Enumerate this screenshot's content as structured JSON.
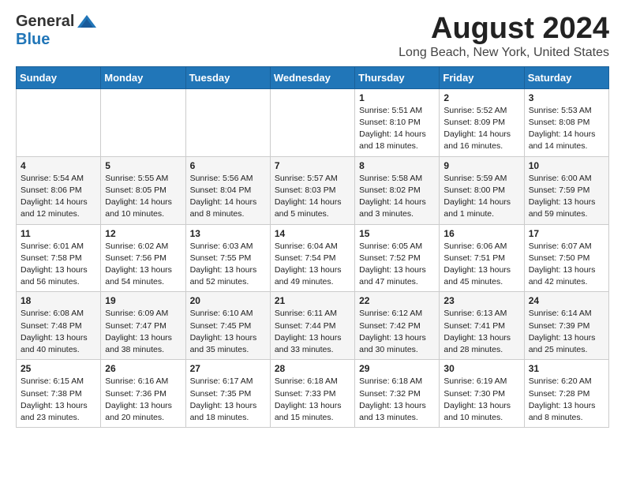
{
  "header": {
    "logo_general": "General",
    "logo_blue": "Blue",
    "title": "August 2024",
    "subtitle": "Long Beach, New York, United States"
  },
  "days_of_week": [
    "Sunday",
    "Monday",
    "Tuesday",
    "Wednesday",
    "Thursday",
    "Friday",
    "Saturday"
  ],
  "weeks": [
    [
      {
        "day": "",
        "detail": ""
      },
      {
        "day": "",
        "detail": ""
      },
      {
        "day": "",
        "detail": ""
      },
      {
        "day": "",
        "detail": ""
      },
      {
        "day": "1",
        "detail": "Sunrise: 5:51 AM\nSunset: 8:10 PM\nDaylight: 14 hours\nand 18 minutes."
      },
      {
        "day": "2",
        "detail": "Sunrise: 5:52 AM\nSunset: 8:09 PM\nDaylight: 14 hours\nand 16 minutes."
      },
      {
        "day": "3",
        "detail": "Sunrise: 5:53 AM\nSunset: 8:08 PM\nDaylight: 14 hours\nand 14 minutes."
      }
    ],
    [
      {
        "day": "4",
        "detail": "Sunrise: 5:54 AM\nSunset: 8:06 PM\nDaylight: 14 hours\nand 12 minutes."
      },
      {
        "day": "5",
        "detail": "Sunrise: 5:55 AM\nSunset: 8:05 PM\nDaylight: 14 hours\nand 10 minutes."
      },
      {
        "day": "6",
        "detail": "Sunrise: 5:56 AM\nSunset: 8:04 PM\nDaylight: 14 hours\nand 8 minutes."
      },
      {
        "day": "7",
        "detail": "Sunrise: 5:57 AM\nSunset: 8:03 PM\nDaylight: 14 hours\nand 5 minutes."
      },
      {
        "day": "8",
        "detail": "Sunrise: 5:58 AM\nSunset: 8:02 PM\nDaylight: 14 hours\nand 3 minutes."
      },
      {
        "day": "9",
        "detail": "Sunrise: 5:59 AM\nSunset: 8:00 PM\nDaylight: 14 hours\nand 1 minute."
      },
      {
        "day": "10",
        "detail": "Sunrise: 6:00 AM\nSunset: 7:59 PM\nDaylight: 13 hours\nand 59 minutes."
      }
    ],
    [
      {
        "day": "11",
        "detail": "Sunrise: 6:01 AM\nSunset: 7:58 PM\nDaylight: 13 hours\nand 56 minutes."
      },
      {
        "day": "12",
        "detail": "Sunrise: 6:02 AM\nSunset: 7:56 PM\nDaylight: 13 hours\nand 54 minutes."
      },
      {
        "day": "13",
        "detail": "Sunrise: 6:03 AM\nSunset: 7:55 PM\nDaylight: 13 hours\nand 52 minutes."
      },
      {
        "day": "14",
        "detail": "Sunrise: 6:04 AM\nSunset: 7:54 PM\nDaylight: 13 hours\nand 49 minutes."
      },
      {
        "day": "15",
        "detail": "Sunrise: 6:05 AM\nSunset: 7:52 PM\nDaylight: 13 hours\nand 47 minutes."
      },
      {
        "day": "16",
        "detail": "Sunrise: 6:06 AM\nSunset: 7:51 PM\nDaylight: 13 hours\nand 45 minutes."
      },
      {
        "day": "17",
        "detail": "Sunrise: 6:07 AM\nSunset: 7:50 PM\nDaylight: 13 hours\nand 42 minutes."
      }
    ],
    [
      {
        "day": "18",
        "detail": "Sunrise: 6:08 AM\nSunset: 7:48 PM\nDaylight: 13 hours\nand 40 minutes."
      },
      {
        "day": "19",
        "detail": "Sunrise: 6:09 AM\nSunset: 7:47 PM\nDaylight: 13 hours\nand 38 minutes."
      },
      {
        "day": "20",
        "detail": "Sunrise: 6:10 AM\nSunset: 7:45 PM\nDaylight: 13 hours\nand 35 minutes."
      },
      {
        "day": "21",
        "detail": "Sunrise: 6:11 AM\nSunset: 7:44 PM\nDaylight: 13 hours\nand 33 minutes."
      },
      {
        "day": "22",
        "detail": "Sunrise: 6:12 AM\nSunset: 7:42 PM\nDaylight: 13 hours\nand 30 minutes."
      },
      {
        "day": "23",
        "detail": "Sunrise: 6:13 AM\nSunset: 7:41 PM\nDaylight: 13 hours\nand 28 minutes."
      },
      {
        "day": "24",
        "detail": "Sunrise: 6:14 AM\nSunset: 7:39 PM\nDaylight: 13 hours\nand 25 minutes."
      }
    ],
    [
      {
        "day": "25",
        "detail": "Sunrise: 6:15 AM\nSunset: 7:38 PM\nDaylight: 13 hours\nand 23 minutes."
      },
      {
        "day": "26",
        "detail": "Sunrise: 6:16 AM\nSunset: 7:36 PM\nDaylight: 13 hours\nand 20 minutes."
      },
      {
        "day": "27",
        "detail": "Sunrise: 6:17 AM\nSunset: 7:35 PM\nDaylight: 13 hours\nand 18 minutes."
      },
      {
        "day": "28",
        "detail": "Sunrise: 6:18 AM\nSunset: 7:33 PM\nDaylight: 13 hours\nand 15 minutes."
      },
      {
        "day": "29",
        "detail": "Sunrise: 6:18 AM\nSunset: 7:32 PM\nDaylight: 13 hours\nand 13 minutes."
      },
      {
        "day": "30",
        "detail": "Sunrise: 6:19 AM\nSunset: 7:30 PM\nDaylight: 13 hours\nand 10 minutes."
      },
      {
        "day": "31",
        "detail": "Sunrise: 6:20 AM\nSunset: 7:28 PM\nDaylight: 13 hours\nand 8 minutes."
      }
    ]
  ]
}
